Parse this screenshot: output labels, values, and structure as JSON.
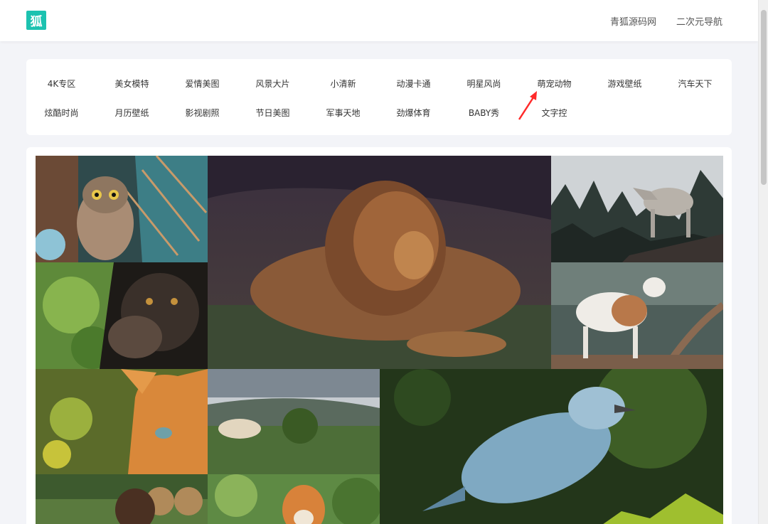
{
  "header": {
    "logo_text": "狐",
    "nav": [
      "青狐源码网",
      "二次元导航"
    ]
  },
  "categories": {
    "row1": [
      "4K专区",
      "美女模特",
      "爱情美图",
      "风景大片",
      "小清新",
      "动漫卡通",
      "明星风尚",
      "萌宠动物",
      "游戏壁纸",
      "汽车天下"
    ],
    "row2": [
      "炫酷时尚",
      "月历壁纸",
      "影视剧照",
      "节日美图",
      "军事天地",
      "劲爆体育",
      "BABY秀",
      "文字控"
    ]
  },
  "annotation": {
    "arrow_color": "#ff2a2a",
    "icon": "red-arrow-icon"
  },
  "gallery": {
    "photos": [
      "owl",
      "lion",
      "wolf",
      "chimpanzee",
      "goat",
      "cat",
      "sheep",
      "bird",
      "dog",
      "tiger"
    ]
  }
}
